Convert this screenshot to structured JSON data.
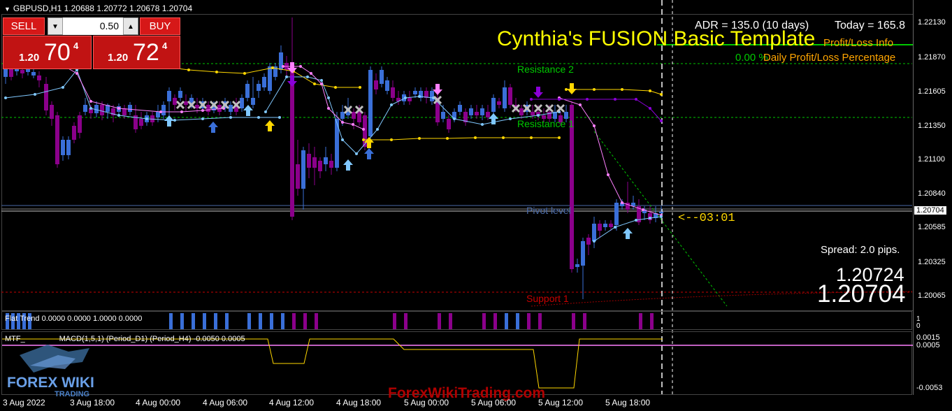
{
  "header": {
    "symbol_info": "GBPUSD,H1  1.20688 1.20772 1.20678 1.20704"
  },
  "trade_panel": {
    "sell_label": "SELL",
    "buy_label": "BUY",
    "lot_value": "0.50",
    "sell_prefix": "1.20",
    "sell_big": "70",
    "sell_sup": "4",
    "buy_prefix": "1.20",
    "buy_big": "72",
    "buy_sup": "4"
  },
  "overlay": {
    "title": "Cynthia's FUSION Basic Template",
    "adr_text": "ADR = 135.0  (10 days)",
    "today_text": "Today = 165.8",
    "pl_info": "Profit/Loss Info",
    "pl_value": "0.00 %",
    "pl_pct_label": "Daily Profit/Loss Percentage",
    "countdown": "<--03:01",
    "spread": "Spread: 2.0 pips.",
    "ask_price": "1.20724",
    "bid_price": "1.20704"
  },
  "levels": {
    "resistance2": "Resistance 2",
    "resistance1": "Resistance 1",
    "pivot": "Pivot level",
    "support1": "Support 1"
  },
  "price_axis": {
    "ticks": [
      "1.22130",
      "1.21870",
      "1.21605",
      "1.21350",
      "1.21100",
      "1.20840",
      "1.20585",
      "1.20325",
      "1.20065"
    ],
    "current_price_box": "1.20704"
  },
  "flat_trend": {
    "label": "Flat Trend 0.0000 0.0000 1.0000 0.0000",
    "scale_top": "1",
    "scale_bottom": "0"
  },
  "macd": {
    "label": "MTF_                MACD(1,5,1) (Period_D1) (Period_H4) -0.0050 0.0005",
    "scale": [
      "0.0015",
      "0.0005",
      "-0.0053"
    ]
  },
  "time_axis": {
    "labels": [
      "3 Aug 2022",
      "3 Aug 18:00",
      "4 Aug 00:00",
      "4 Aug 06:00",
      "4 Aug 12:00",
      "4 Aug 18:00",
      "5 Aug 00:00",
      "5 Aug 06:00",
      "5 Aug 12:00",
      "5 Aug 18:00"
    ]
  },
  "watermark": {
    "logo_text_1": "FOREX WIKI",
    "logo_text_2": "TRADING",
    "site": "ForexWikiTrading.com"
  },
  "colors": {
    "bull": "#3a6fd8",
    "bear": "#8b008b",
    "resistance": "#00c800",
    "support": "#c80000",
    "yellow": "#ffd700",
    "pink": "#ff80ff",
    "lightblue": "#80c8ff"
  }
}
